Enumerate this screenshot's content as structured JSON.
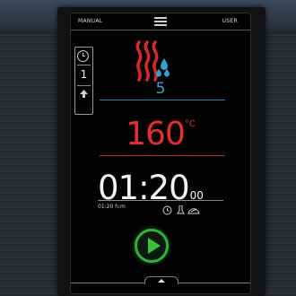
{
  "topbar": {
    "left_label": "MANUAL",
    "right_label": "USER"
  },
  "side_panel": {
    "step_number": "1"
  },
  "mode": {
    "humidity_value": "5",
    "icon": "combi-steam-icon"
  },
  "temperature": {
    "value": "160",
    "unit": "°C"
  },
  "timer": {
    "main": "01:20",
    "seconds": "00",
    "end_time": "01:20 h:m"
  },
  "colors": {
    "humidity": "#2fa4d2",
    "temperature": "#e52e2e",
    "play": "#32b03d",
    "heat": "#d8272b"
  }
}
